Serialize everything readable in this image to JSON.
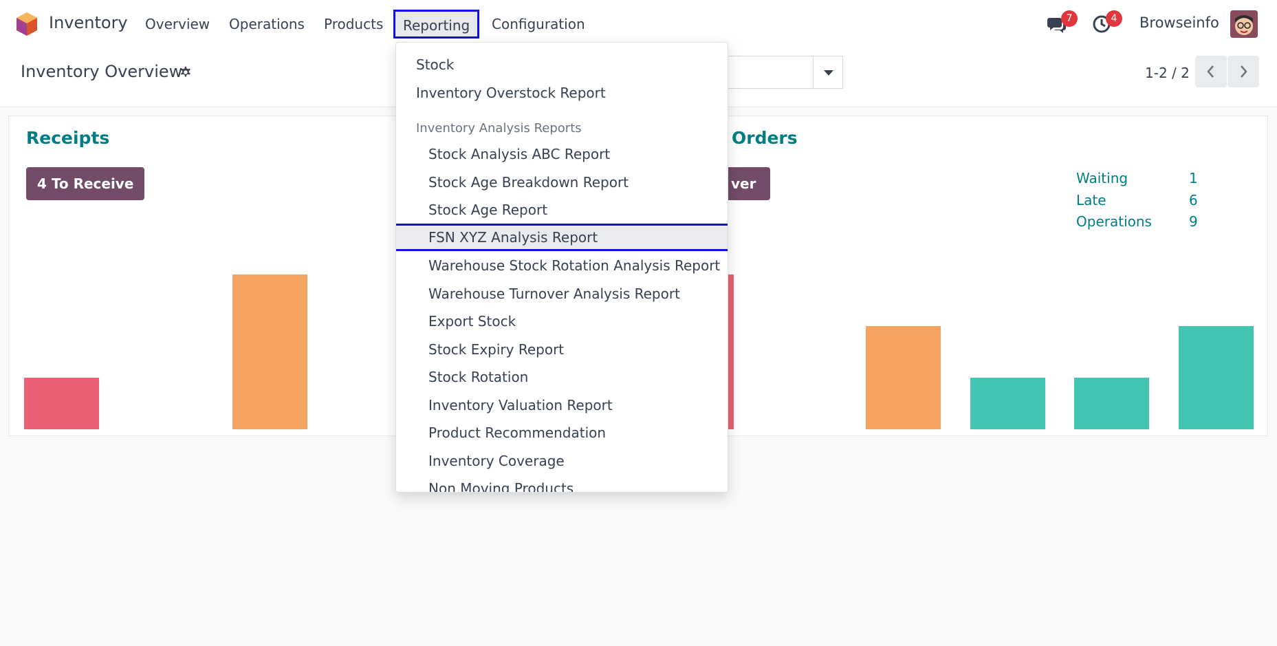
{
  "navbar": {
    "app_name": "Inventory",
    "menu": [
      "Overview",
      "Operations",
      "Products",
      "Reporting",
      "Configuration"
    ],
    "active_menu": "Reporting",
    "messages_count": "7",
    "activities_count": "4",
    "company": "Browseinfo"
  },
  "control_panel": {
    "title": "Inventory Overview",
    "pager": "1-2 / 2"
  },
  "dashboard": {
    "left_card": {
      "title": "Receipts",
      "button": "4 To Receive"
    },
    "right_card": {
      "title_partial": "Orders",
      "button_partial": "ver",
      "stats": [
        {
          "label": "Waiting",
          "value": "1"
        },
        {
          "label": "Late",
          "value": "6"
        },
        {
          "label": "Operations",
          "value": "9"
        }
      ]
    },
    "colors": {
      "red": "#ea6175",
      "orange": "#f4a460",
      "teal": "#43c5b1",
      "title": "#017e84",
      "button": "#714b67"
    }
  },
  "reporting_menu": {
    "top_items": [
      "Stock",
      "Inventory Overstock Report"
    ],
    "section_header": "Inventory Analysis Reports",
    "section_items": [
      "Stock Analysis ABC Report",
      "Stock Age Breakdown Report",
      "Stock Age Report",
      "FSN XYZ Analysis Report",
      "Warehouse Stock Rotation Analysis Report",
      "Warehouse Turnover Analysis Report",
      "Export Stock",
      "Stock Expiry Report",
      "Stock Rotation",
      "Inventory Valuation Report",
      "Product Recommendation",
      "Inventory Coverage",
      "Non Moving Products"
    ],
    "highlighted_item": "FSN XYZ Analysis Report"
  }
}
